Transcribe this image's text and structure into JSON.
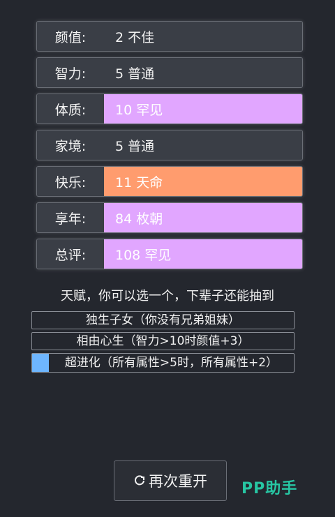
{
  "stats": [
    {
      "label": "颜值:",
      "value": "2 不佳",
      "grade": "normal"
    },
    {
      "label": "智力:",
      "value": "5 普通",
      "grade": "normal"
    },
    {
      "label": "体质:",
      "value": "10 罕见",
      "grade": "rare"
    },
    {
      "label": "家境:",
      "value": "5 普通",
      "grade": "normal"
    },
    {
      "label": "快乐:",
      "value": "11 天命",
      "grade": "legend"
    },
    {
      "label": "享年:",
      "value": "84 枚朝",
      "grade": "rare"
    },
    {
      "label": "总评:",
      "value": "108 罕见",
      "grade": "rare"
    }
  ],
  "talents": {
    "title": "天赋，你可以选一个，下辈子还能抽到",
    "items": [
      {
        "text": "独生子女（你没有兄弟姐妹）",
        "selected": false
      },
      {
        "text": "相由心生（智力>10时颜值+3）",
        "selected": false
      },
      {
        "text": "超进化（所有属性>5时，所有属性+2）",
        "selected": true
      }
    ]
  },
  "restart": {
    "label": "再次重开",
    "icon": "refresh-icon"
  },
  "watermark": {
    "text": "PP助手"
  },
  "colors": {
    "rare": "#e1a6ff",
    "legend": "#ff9c6e",
    "selected": "#6eb6ff",
    "background": "#24272e"
  }
}
